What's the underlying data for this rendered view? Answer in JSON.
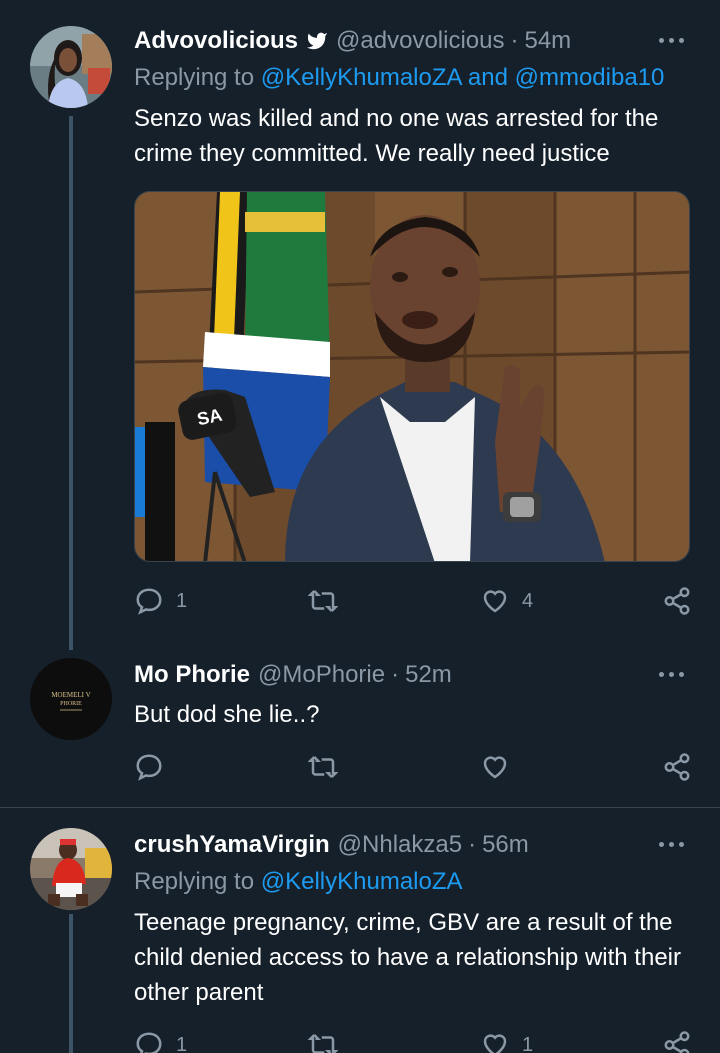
{
  "tweets": [
    {
      "name": "Advovolicious",
      "verified": true,
      "handle": "@advovolicious",
      "time": "54m",
      "replying_label": "Replying to",
      "reply_targets": [
        "@KellyKhumaloZA",
        "@mmodiba10"
      ],
      "reply_joiner": "and",
      "text": "Senzo was killed and no one was arrested for the crime they committed. We really need justice",
      "counts": {
        "reply": "1",
        "retweet": "",
        "like": "4"
      }
    },
    {
      "name": "Mo Phorie",
      "handle": "@MoPhorie",
      "time": "52m",
      "avatar_text": [
        "MOEMELI V",
        "PHORIE"
      ],
      "text": "But dod she lie..?",
      "counts": {
        "reply": "",
        "retweet": "",
        "like": ""
      }
    },
    {
      "name": "crushYamaVirgin",
      "handle": "@Nhlakza5",
      "time": "56m",
      "replying_label": "Replying to",
      "reply_targets": [
        "@KellyKhumaloZA"
      ],
      "text": "Teenage pregnancy, crime, GBV are a result of the child denied access to have a relationship with their other parent",
      "counts": {
        "reply": "1",
        "retweet": "",
        "like": "1"
      }
    }
  ],
  "media_overlay_text": "SA",
  "icons": [
    "verified-badge-icon",
    "more-icon",
    "reply-icon",
    "retweet-icon",
    "like-icon",
    "share-icon"
  ],
  "colors": {
    "background": "#15202b",
    "link": "#1d9bf0",
    "secondary": "#8b98a5",
    "divider": "#38444d"
  }
}
